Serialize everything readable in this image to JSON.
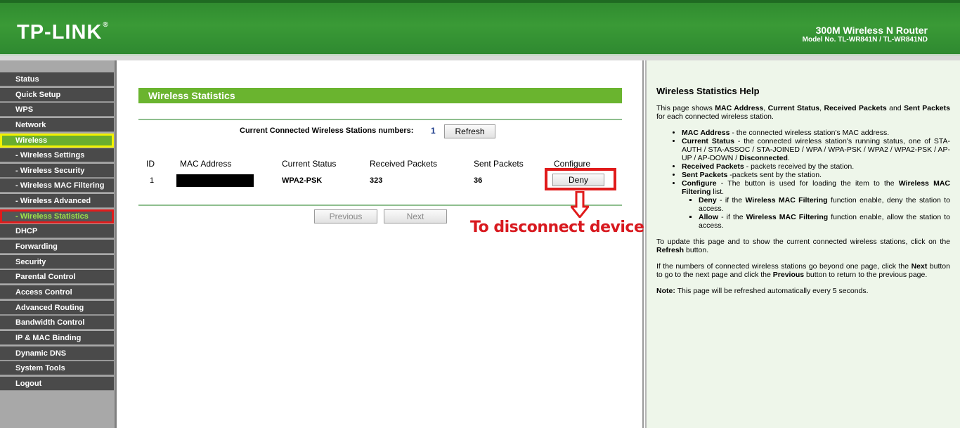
{
  "header": {
    "logo": "TP-LINK",
    "logo_mark": "®",
    "product_name": "300M Wireless N Router",
    "model_no": "Model No. TL-WR841N / TL-WR841ND"
  },
  "sidebar": {
    "items": [
      {
        "label": "Status"
      },
      {
        "label": "Quick Setup"
      },
      {
        "label": "WPS"
      },
      {
        "label": "Network"
      },
      {
        "label": "Wireless"
      },
      {
        "label": "- Wireless Settings"
      },
      {
        "label": "- Wireless Security"
      },
      {
        "label": "- Wireless MAC Filtering"
      },
      {
        "label": "- Wireless Advanced"
      },
      {
        "label": "- Wireless Statistics"
      },
      {
        "label": "DHCP"
      },
      {
        "label": "Forwarding"
      },
      {
        "label": "Security"
      },
      {
        "label": "Parental Control"
      },
      {
        "label": "Access Control"
      },
      {
        "label": "Advanced Routing"
      },
      {
        "label": "Bandwidth Control"
      },
      {
        "label": "IP & MAC Binding"
      },
      {
        "label": "Dynamic DNS"
      },
      {
        "label": "System Tools"
      },
      {
        "label": "Logout"
      }
    ]
  },
  "main": {
    "title": "Wireless Statistics",
    "stations_label": "Current Connected Wireless Stations numbers:",
    "stations_count": "1",
    "refresh_label": "Refresh",
    "table": {
      "headers": [
        "ID",
        "MAC Address",
        "Current Status",
        "Received Packets",
        "Sent Packets",
        "Configure"
      ],
      "rows": [
        {
          "id": "1",
          "mac": "",
          "status": "WPA2-PSK",
          "received": "323",
          "sent": "36",
          "action": "Deny"
        }
      ]
    },
    "previous_label": "Previous",
    "next_label": "Next",
    "annotation": "To disconnect device"
  },
  "help": {
    "title": "Wireless Statistics Help",
    "intro_a": "This page shows ",
    "intro_b1": "MAC Address",
    "intro_c": ", ",
    "intro_b2": "Current Status",
    "intro_d": ", ",
    "intro_b3": "Received Packets",
    "intro_e": " and ",
    "intro_b4": "Sent Packets",
    "intro_f": " for each connected wireless station.",
    "items": {
      "mac_term": "MAC Address",
      "mac_desc": " - the connected wireless station's MAC address.",
      "status_term": "Current Status",
      "status_desc": " - the connected wireless station's running status, one of STA-AUTH / STA-ASSOC / STA-JOINED / WPA / WPA-PSK / WPA2 / WPA2-PSK / AP-UP / AP-DOWN / ",
      "status_desc_b": "Disconnected",
      "status_desc_end": ".",
      "recv_term": "Received Packets",
      "recv_desc": " - packets received by the station.",
      "sent_term": "Sent Packets",
      "sent_desc": " -packets sent by the station.",
      "config_term": "Configure",
      "config_desc": " - The button is used for loading the item to the ",
      "config_desc_b": "Wireless MAC Filtering",
      "config_desc_end": " list.",
      "deny_term": "Deny",
      "deny_desc": " - if the ",
      "deny_desc_b": "Wireless MAC Filtering",
      "deny_desc_end": " function enable, deny the station to access.",
      "allow_term": "Allow",
      "allow_desc": " - if the ",
      "allow_desc_b": "Wireless MAC Filtering",
      "allow_desc_end": " function enable, allow the station to access."
    },
    "update_a": "To update this page and to show the current connected wireless stations, click on the ",
    "update_b": "Refresh",
    "update_c": " button.",
    "pages_a": "If the numbers of connected wireless stations go beyond one page, click the ",
    "pages_b": "Next",
    "pages_c": " button to go to the next page and click the ",
    "pages_d": "Previous",
    "pages_e": " button to return to the previous page.",
    "note_b": "Note:",
    "note_a": " This page will be refreshed automatically every 5 seconds."
  },
  "colors": {
    "header_green": "#3a9a36",
    "title_green": "#6ab42f",
    "nav_dark": "#4a4a4a",
    "active_yellow": "#f2f200",
    "highlight_red": "#e01b1b",
    "help_bg": "#eef6ea"
  }
}
